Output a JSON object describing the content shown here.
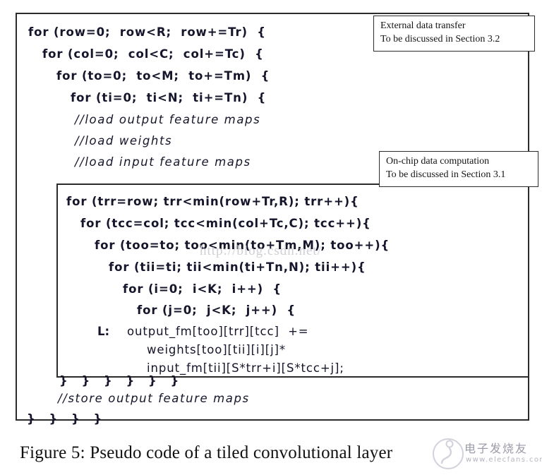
{
  "figure": {
    "caption": "Figure 5: Pseudo code of a tiled convolutional layer",
    "border_color": "#2b2b2b"
  },
  "outer_code": {
    "lines": [
      {
        "id": "l1",
        "text": "for (row=0;  row<R;  row+=Tr)  {",
        "style": "keyword",
        "indent": 0
      },
      {
        "id": "l2",
        "text": "for (col=0;  col<C;  col+=Tc)  {",
        "style": "keyword",
        "indent": 1
      },
      {
        "id": "l3",
        "text": "for (to=0;  to<M;  to+=Tm)  {",
        "style": "keyword",
        "indent": 2
      },
      {
        "id": "l4",
        "text": "for (ti=0;  ti<N;  ti+=Tn)  {",
        "style": "keyword",
        "indent": 3
      },
      {
        "id": "l5",
        "text": "//load output feature maps",
        "style": "comment",
        "indent": 3
      },
      {
        "id": "l6",
        "text": "//load weights",
        "style": "comment",
        "indent": 3
      },
      {
        "id": "l7",
        "text": "//load input feature maps",
        "style": "comment",
        "indent": 3
      }
    ],
    "store_comment": "//store output feature maps",
    "closing_braces": "} } } }"
  },
  "inner_code": {
    "lines": [
      {
        "id": "i1",
        "text": "for (trr=row; trr<min(row+Tr,R); trr++){",
        "style": "keyword"
      },
      {
        "id": "i2",
        "text": "for (tcc=col; tcc<min(col+Tc,C); tcc++){",
        "style": "keyword"
      },
      {
        "id": "i3",
        "text": "for (too=to; too<min(to+Tm,M); too++){",
        "style": "keyword"
      },
      {
        "id": "i4",
        "text": "for (tii=ti; tii<min(ti+Tn,N); tii++){",
        "style": "keyword"
      },
      {
        "id": "i5",
        "text": "for (i=0;  i<K;  i++)  {",
        "style": "keyword"
      },
      {
        "id": "i6",
        "text": "for (j=0;  j<K;  j++)  {",
        "style": "keyword"
      }
    ],
    "label": "L:",
    "statement_1": "output_fm[too][trr][tcc]  +=",
    "statement_2": "weights[too][tii][i][j]*",
    "statement_3": "input_fm[tii][S*trr+i][S*tcc+j];",
    "closing_braces": "} } } } } }"
  },
  "callouts": [
    {
      "id": "external-data-transfer",
      "line1": "External data transfer",
      "line2": "To be discussed in Section 3.2"
    },
    {
      "id": "on-chip-data-computation",
      "line1": "On-chip data computation",
      "line2": "To be discussed in Section 3.1"
    }
  ],
  "watermarks": {
    "url": "http://blog.csdn.net/",
    "brand_cn": "电子发烧友",
    "brand_url": "www.elecfans.com"
  }
}
